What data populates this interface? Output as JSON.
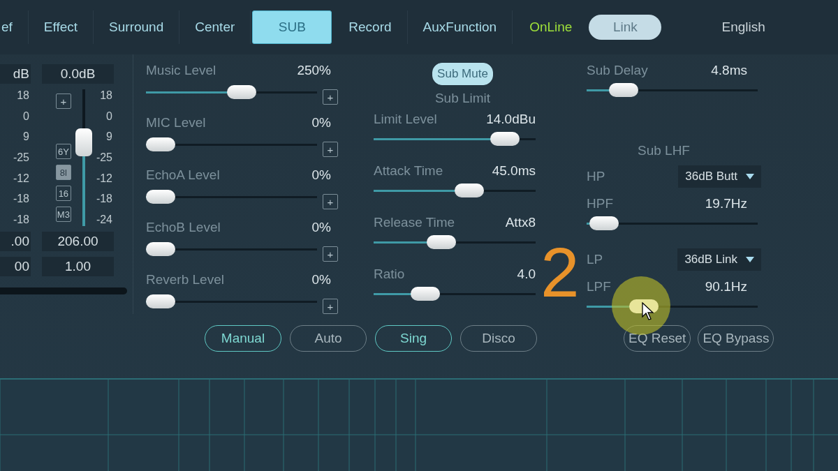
{
  "tabs": [
    {
      "label": "ef",
      "selected": false
    },
    {
      "label": "Effect",
      "selected": false
    },
    {
      "label": "Surround",
      "selected": false
    },
    {
      "label": "Center",
      "selected": false
    },
    {
      "label": "SUB",
      "selected": true
    },
    {
      "label": "Record",
      "selected": false
    },
    {
      "label": "AuxFunction",
      "selected": false
    }
  ],
  "status": "OnLine",
  "link_button": "Link",
  "language": "English",
  "meters": [
    {
      "gain": "dB",
      "scale": [
        "18",
        "0",
        "9",
        "-25",
        "-12",
        "-18",
        "-18"
      ],
      "value_1": ".00",
      "value_2": "00"
    },
    {
      "gain": "0.0dB",
      "scale": [
        "18",
        "0",
        "9",
        "-25",
        "-12",
        "-18",
        "-24"
      ],
      "value_1": "206.00",
      "value_2": "1.00",
      "fader": {
        "level": 0.64,
        "plus": "+",
        "modes": [
          {
            "label": "6Y",
            "selected": false
          },
          {
            "label": "8l",
            "selected": true
          },
          {
            "label": "16",
            "selected": false
          },
          {
            "label": "M3",
            "selected": false
          }
        ]
      }
    }
  ],
  "levels": [
    {
      "label": "Music Level",
      "value": "250%",
      "level": 0.57,
      "plus": "+"
    },
    {
      "label": "MIC Level",
      "value": "0%",
      "level": 0,
      "plus": "+"
    },
    {
      "label": "EchoA Level",
      "value": "0%",
      "level": 0,
      "plus": "+"
    },
    {
      "label": "EchoB Level",
      "value": "0%",
      "level": 0,
      "plus": "+"
    },
    {
      "label": "Reverb Level",
      "value": "0%",
      "level": 0,
      "plus": "+"
    }
  ],
  "sub_mute": {
    "label": "Sub Mute",
    "on": true
  },
  "sub_limit": {
    "title": "Sub Limit",
    "sliders": [
      {
        "label": "Limit Level",
        "value": "14.0dBu",
        "level": 0.88
      },
      {
        "label": "Attack Time",
        "value": "45.0ms",
        "level": 0.61
      },
      {
        "label": "Release Time",
        "value": "Attx8",
        "level": 0.4
      },
      {
        "label": "Ratio",
        "value": "4.0",
        "level": 0.28
      }
    ]
  },
  "sub_delay": {
    "label": "Sub Delay",
    "value": "4.8ms",
    "level": 0.16
  },
  "sub_lhf": {
    "title": "Sub LHF",
    "rows": [
      {
        "kind": "dropdown",
        "label": "HP",
        "value": "36dB Butt"
      },
      {
        "kind": "slider",
        "label": "HPF",
        "value": "19.7Hz",
        "level": 0.02,
        "hovered": false
      },
      {
        "kind": "dropdown",
        "label": "LP",
        "value": "36dB Link"
      },
      {
        "kind": "slider",
        "label": "LPF",
        "value": "90.1Hz",
        "level": 0.3,
        "hovered": true
      }
    ]
  },
  "presets": [
    {
      "label": "Manual",
      "selected": true
    },
    {
      "label": "Auto",
      "selected": false
    },
    {
      "label": "Sing",
      "selected": true
    },
    {
      "label": "Disco",
      "selected": false
    }
  ],
  "eq_buttons": [
    "EQ Reset",
    "EQ Bypass"
  ],
  "annotation": "2"
}
